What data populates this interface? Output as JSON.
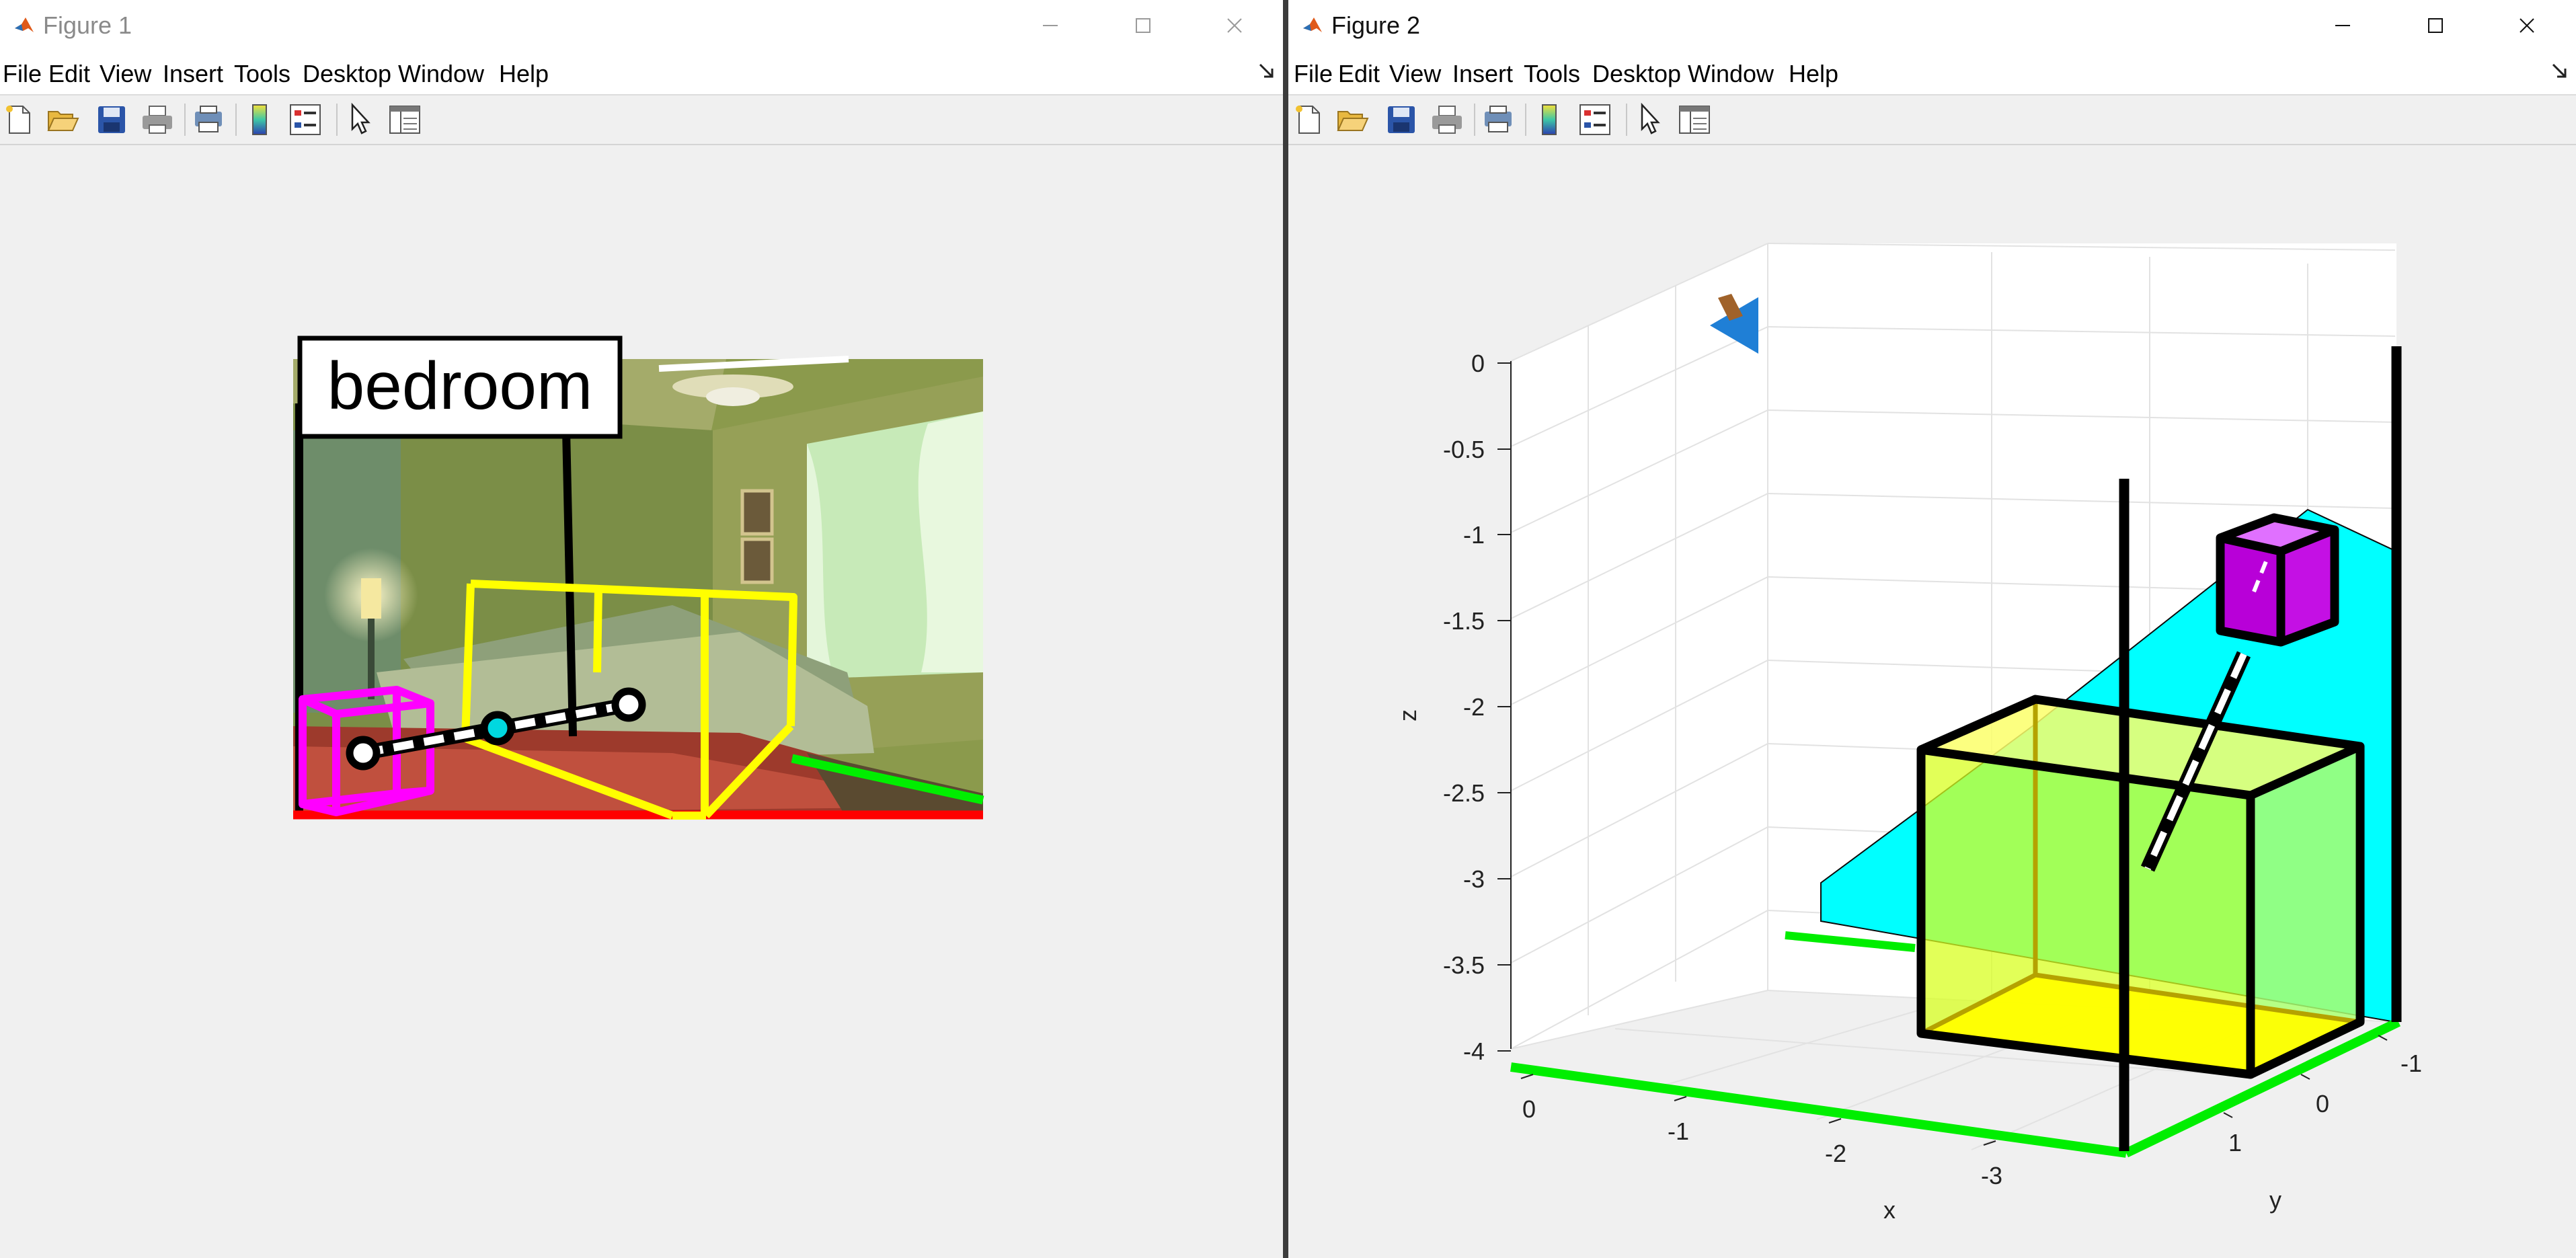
{
  "figure1": {
    "title": "Figure 1",
    "menu": [
      "File",
      "Edit",
      "View",
      "Insert",
      "Tools",
      "Desktop",
      "Window",
      "Help"
    ],
    "scene_label": "bedroom"
  },
  "figure2": {
    "title": "Figure 2",
    "menu": [
      "File",
      "Edit",
      "View",
      "Insert",
      "Tools",
      "Desktop",
      "Window",
      "Help"
    ],
    "axes": {
      "xlabel": "x",
      "ylabel": "y",
      "zlabel": "z",
      "xticks": [
        "0",
        "-1",
        "-2",
        "-3"
      ],
      "yticks": [
        "-1",
        "0",
        "1"
      ],
      "zticks": [
        "0",
        "-0.5",
        "-1",
        "-1.5",
        "-2",
        "-2.5",
        "-3",
        "-3.5",
        "-4"
      ]
    }
  },
  "toolbar_icons": [
    "new-figure-icon",
    "open-file-icon",
    "save-icon",
    "print-icon",
    "print-preview-icon",
    "colorbar-icon",
    "legend-icon",
    "edit-plot-icon",
    "property-editor-icon"
  ],
  "colors": {
    "window_bg": "#f0f0f0",
    "floor_line": "#ff0000",
    "wall_line": "#00ff00",
    "bed_box": "#ffff00",
    "object_box": "#ff00ff",
    "cyan_plane": "#00ffff",
    "camera": "#1f7fd6"
  }
}
